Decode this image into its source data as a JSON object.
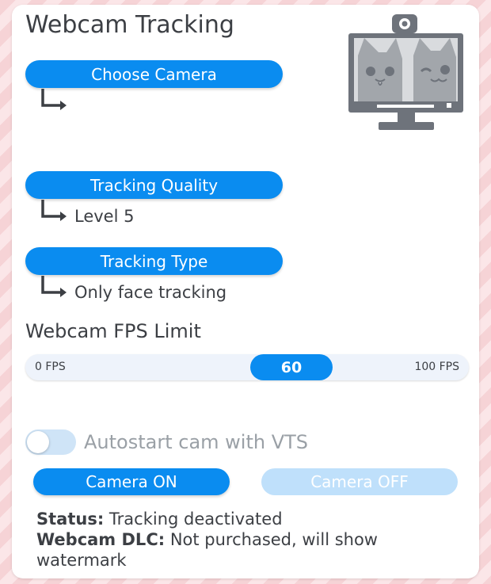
{
  "panel": {
    "title": "Webcam Tracking"
  },
  "choose_camera": {
    "label": "Choose Camera",
    "value": ""
  },
  "tracking_quality": {
    "label": "Tracking Quality",
    "value": "Level 5"
  },
  "tracking_type": {
    "label": "Tracking Type",
    "value": "Only face tracking"
  },
  "fps_limit": {
    "label": "Webcam FPS Limit",
    "min_label": "0 FPS",
    "max_label": "100 FPS",
    "value": "60",
    "min": 0,
    "max": 100
  },
  "autostart": {
    "label": "Autostart cam with VTS",
    "enabled": false
  },
  "buttons": {
    "camera_on": "Camera ON",
    "camera_off": "Camera OFF"
  },
  "status": {
    "status_key": "Status:",
    "status_value": "Tracking deactivated",
    "dlc_key": "Webcam DLC:",
    "dlc_value": "Not purchased, will show watermark"
  },
  "icons": {
    "monitor": "webcam-monitor-cats-icon",
    "arrow": "elbow-arrow-icon"
  },
  "colors": {
    "accent": "#0a8cf0",
    "accent_disabled": "#bfe0fb",
    "text": "#3c3f44",
    "muted_text": "#9aa0a6",
    "background_stripe_a": "#f6d3d6",
    "background_stripe_b": "#fbe6e8"
  }
}
